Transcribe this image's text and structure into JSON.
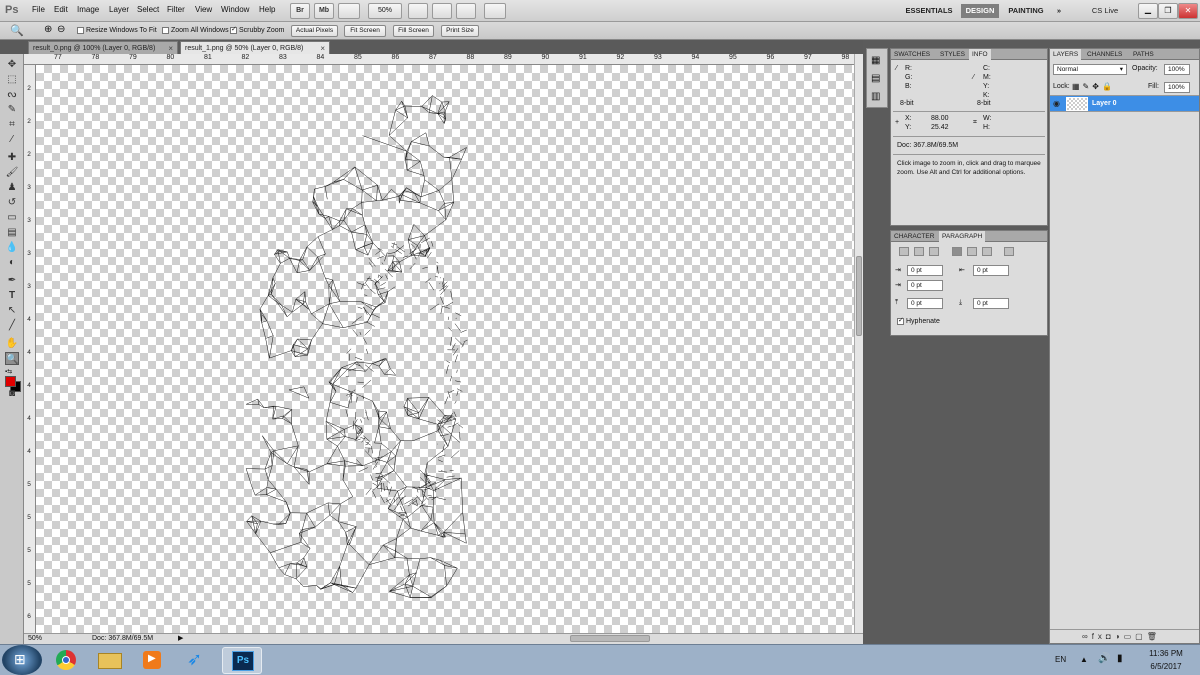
{
  "app": {
    "logo": "Ps"
  },
  "menu": [
    "File",
    "Edit",
    "Image",
    "Layer",
    "Select",
    "Filter",
    "View",
    "Window",
    "Help"
  ],
  "menubar": {
    "bridge": "Br",
    "minibridge": "Mb",
    "zoom": "50%"
  },
  "workspaces": {
    "essentials": "ESSENTIALS",
    "design": "DESIGN",
    "painting": "PAINTING",
    "more": "»",
    "cslive": "CS Live"
  },
  "options": {
    "resize": "Resize Windows To Fit",
    "zoom_all": "Zoom All Windows",
    "scrubby": "Scrubby Zoom",
    "actual": "Actual Pixels",
    "fit": "Fit Screen",
    "fill": "Fill Screen",
    "print": "Print Size"
  },
  "tabs": [
    {
      "label": "result_0.png @ 100% (Layer 0, RGB/8)"
    },
    {
      "label": "result_1.png @ 50% (Layer 0, RGB/8)"
    }
  ],
  "ruler": {
    "h": [
      "77",
      "78",
      "79",
      "80",
      "81",
      "82",
      "83",
      "84",
      "85",
      "86",
      "87",
      "88",
      "89",
      "90",
      "91",
      "92",
      "93",
      "94",
      "95",
      "96",
      "97",
      "98"
    ],
    "v": [
      "2",
      "2",
      "2",
      "3",
      "3",
      "3",
      "3",
      "4",
      "4",
      "4",
      "4",
      "4",
      "5",
      "5",
      "5",
      "5",
      "6"
    ]
  },
  "status": {
    "zoom": "50%",
    "doc": "Doc: 367.8M/69.5M"
  },
  "info": {
    "tabs": [
      "SWATCHES",
      "STYLES",
      "INFO"
    ],
    "r": "R:",
    "g": "G:",
    "b": "B:",
    "c": "C:",
    "m": "M:",
    "y": "Y:",
    "k": "K:",
    "bit1": "8-bit",
    "bit2": "8-bit",
    "x_label": "X:",
    "x": "88.00",
    "y_label": "Y:",
    "yv": "25.42",
    "w": "W:",
    "h": "H:",
    "doc": "Doc: 367.8M/69.5M",
    "help": "Click image to zoom in, click and drag to marquee zoom.  Use Alt and Ctrl for additional options."
  },
  "paragraph": {
    "tabs": [
      "CHARACTER",
      "PARAGRAPH"
    ],
    "indent_left": "0 pt",
    "indent_right": "0 pt",
    "indent_first": "0 pt",
    "space_before": "0 pt",
    "space_after": "0 pt",
    "hyphenate": "Hyphenate"
  },
  "layers": {
    "tabs": [
      "LAYERS",
      "CHANNELS",
      "PATHS"
    ],
    "blend": "Normal",
    "opacity_label": "Opacity:",
    "opacity": "100%",
    "lock_label": "Lock:",
    "fill_label": "Fill:",
    "fill": "100%",
    "layer_name": "Layer 0"
  },
  "taskbar": {
    "lang": "EN",
    "time": "11:36 PM",
    "date": "6/5/2017",
    "ps": "Ps"
  },
  "colors": {
    "foreground": "#e00000",
    "background": "#000000",
    "selected_layer": "#3d8ee6",
    "taskbar": "#9db1c8"
  }
}
